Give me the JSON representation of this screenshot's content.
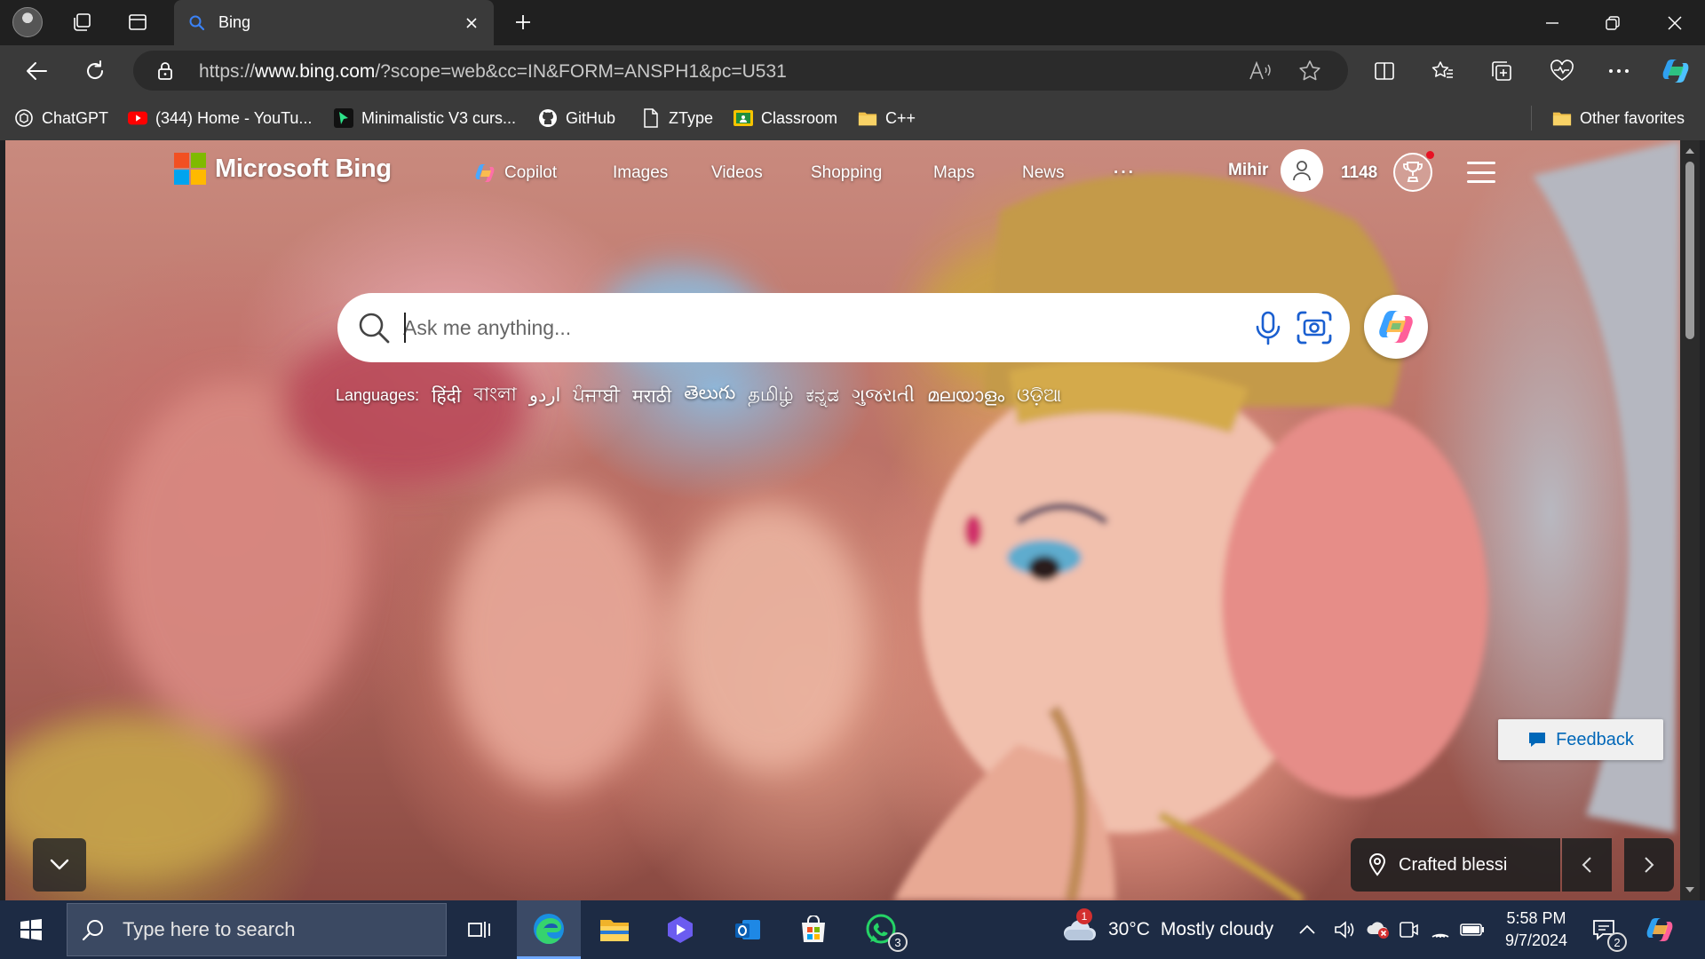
{
  "browser": {
    "tab_title": "Bing",
    "url_prefix": "https://",
    "url_domain": "www.bing.com",
    "url_path": "/?scope=web&cc=IN&FORM=ANSPH1&pc=U531"
  },
  "favorites": {
    "items": [
      {
        "label": "ChatGPT",
        "icon": "chatgpt-icon"
      },
      {
        "label": "(344) Home - YouTu...",
        "icon": "youtube-icon"
      },
      {
        "label": "Minimalistic V3 curs...",
        "icon": "cursor-icon"
      },
      {
        "label": "GitHub",
        "icon": "github-icon"
      },
      {
        "label": "ZType",
        "icon": "page-icon"
      },
      {
        "label": "Classroom",
        "icon": "classroom-icon"
      },
      {
        "label": "C++",
        "icon": "folder-icon"
      }
    ],
    "other_favorites": "Other favorites"
  },
  "bing": {
    "logo_text": "Microsoft Bing",
    "nav": [
      "Copilot",
      "Images",
      "Videos",
      "Shopping",
      "Maps",
      "News"
    ],
    "more": "···",
    "user_name": "Mihir",
    "points": "1148",
    "search_placeholder": "Ask me anything...",
    "languages_label": "Languages:",
    "languages": [
      "हिंदी",
      "বাংলা",
      "اردو",
      "ਪੰਜਾਬੀ",
      "मराठी",
      "తెలుగు",
      "தமிழ்",
      "ಕನ್ನಡ",
      "ગુજરાતી",
      "മലയാളം",
      "ଓଡ଼ିଆ"
    ],
    "caption": "Crafted blessi",
    "feedback": "Feedback"
  },
  "taskbar": {
    "search_placeholder": "Type here to search",
    "whatsapp_badge": "3",
    "weather_badge": "1",
    "temperature": "30°C",
    "condition": "Mostly cloudy",
    "time": "5:58 PM",
    "date": "9/7/2024",
    "notification_count": "2"
  },
  "colors": {
    "ms_red": "#f25022",
    "ms_green": "#7fba00",
    "ms_blue": "#00a4ef",
    "ms_yellow": "#ffb900",
    "feedback_blue": "#0067b8",
    "taskbar_bg": "#1d2b44"
  }
}
